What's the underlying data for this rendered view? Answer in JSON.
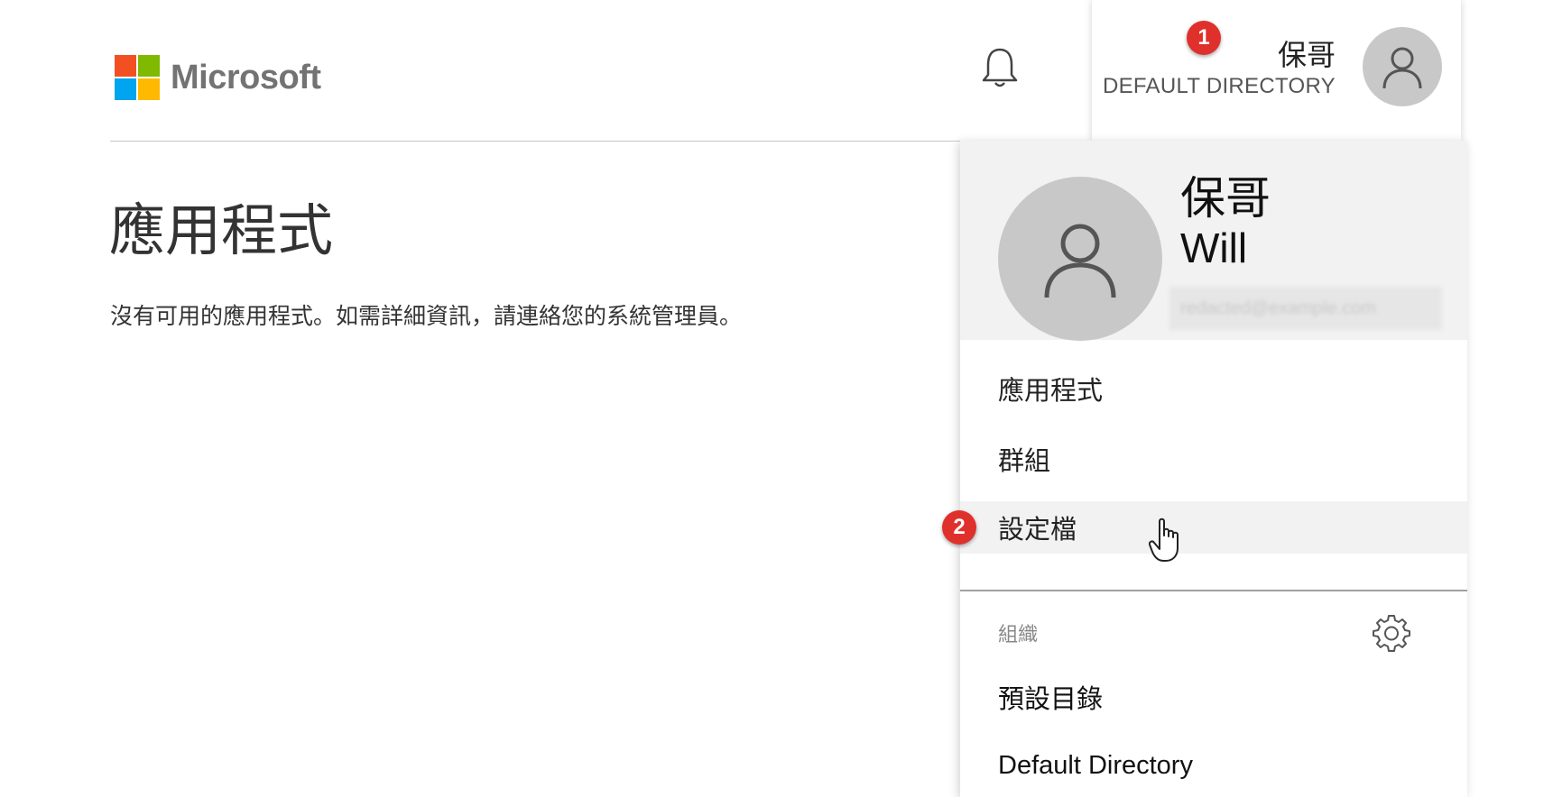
{
  "brand": {
    "name": "Microsoft",
    "logo_colors": [
      "#f25022",
      "#7fba00",
      "#00a4ef",
      "#ffb900"
    ]
  },
  "header": {
    "notifications_icon": "bell-icon",
    "account": {
      "name": "保哥",
      "directory": "DEFAULT DIRECTORY",
      "avatar_icon": "person-icon"
    }
  },
  "main": {
    "title": "應用程式",
    "message": "沒有可用的應用程式。如需詳細資訊，請連絡您的系統管理員。"
  },
  "account_panel": {
    "display_name": "保哥",
    "alias": "Will",
    "email": "redacted@example.com",
    "menu": [
      {
        "label": "應用程式"
      },
      {
        "label": "群組"
      },
      {
        "label": "設定檔"
      }
    ],
    "organizations_label": "組織",
    "settings_icon": "gear-icon",
    "organizations": [
      {
        "label": "預設目錄"
      },
      {
        "label": "Default Directory"
      }
    ]
  },
  "annotations": {
    "step1": "1",
    "step2": "2",
    "badge_color": "#e0302b"
  }
}
